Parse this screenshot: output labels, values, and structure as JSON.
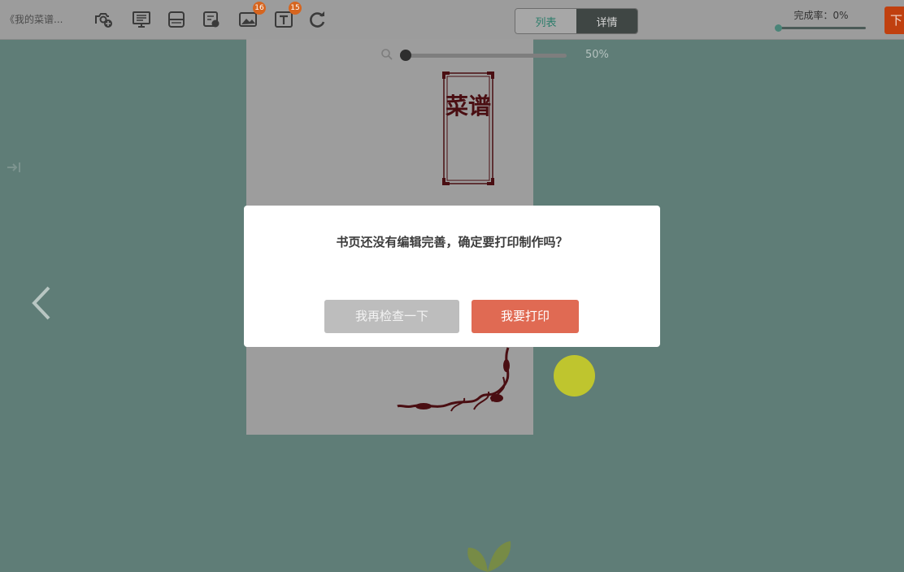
{
  "toolbar": {
    "doc_title": "《我的菜谱...",
    "tools": [
      {
        "name": "add-photo-icon"
      },
      {
        "name": "monitor-icon"
      },
      {
        "name": "layout-icon"
      },
      {
        "name": "edit-page-icon"
      },
      {
        "name": "image-count-icon",
        "badge": "16"
      },
      {
        "name": "text-count-icon",
        "badge": "15"
      },
      {
        "name": "redo-icon"
      }
    ],
    "view_toggle": {
      "list_label": "列表",
      "detail_label": "详情",
      "active": "detail"
    },
    "progress": {
      "label": "完成率：0%",
      "value": 0
    },
    "download_label": "下"
  },
  "canvas": {
    "zoom_value": "50%",
    "zoom_level": 0.5,
    "page_title": "菜谱",
    "colors": {
      "background": "#5f7d77",
      "page": "#9d9d9d",
      "ornament": "#4a0e12"
    }
  },
  "modal": {
    "message": "书页还没有编辑完善，确定要打印制作吗？",
    "check_label": "我再检查一下",
    "print_label": "我要打印",
    "colors": {
      "check": "#bdbdbd",
      "print": "#e06a53"
    }
  }
}
